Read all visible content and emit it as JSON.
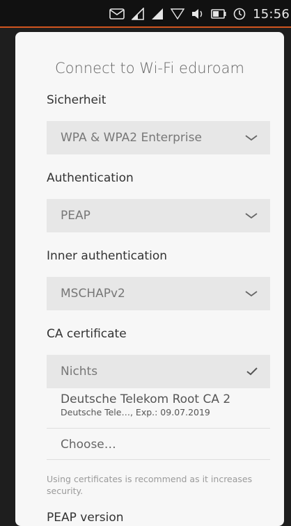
{
  "status": {
    "time": "15:56",
    "icons": [
      "message-icon",
      "signal-icon",
      "signal-icon",
      "wifi-icon",
      "volume-icon",
      "battery-icon",
      "alarm-icon"
    ]
  },
  "dialog": {
    "title": "Connect to Wi-Fi eduroam",
    "security": {
      "label": "Sicherheit",
      "value": "WPA & WPA2 Enterprise"
    },
    "authentication": {
      "label": "Authentication",
      "value": "PEAP"
    },
    "inner_auth": {
      "label": "Inner authentication",
      "value": "MSCHAPv2"
    },
    "ca": {
      "label": "CA certificate",
      "selected": "Nichts",
      "options": [
        {
          "name": "Deutsche Telekom Root CA 2",
          "detail": "Deutsche Tele…, Exp.: 09.07.2019"
        }
      ],
      "choose_label": "Choose…",
      "note": "Using certificates is recommend as it increases security."
    },
    "next_section_label": "PEAP version"
  },
  "colors": {
    "accent": "#d2551f",
    "field": "#e7e7e7",
    "dialog_bg": "#f7f7f7"
  }
}
